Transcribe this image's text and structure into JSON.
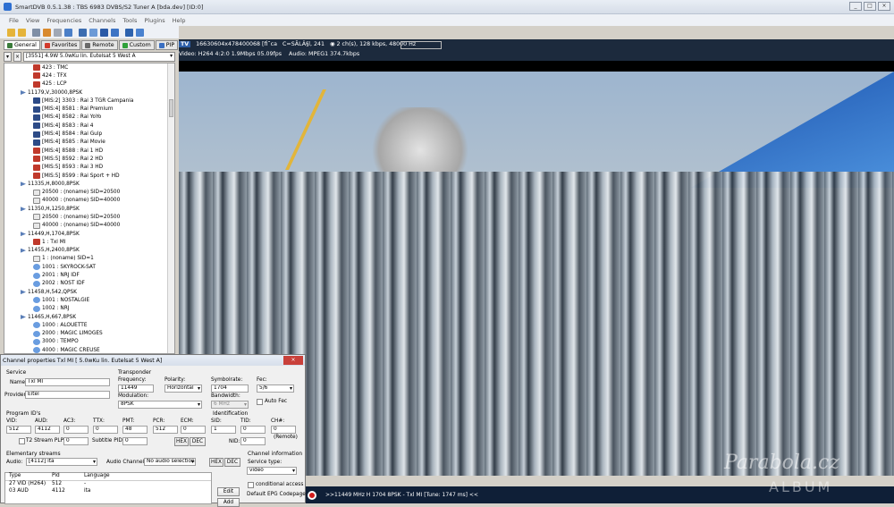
{
  "window": {
    "title": "SmartDVB 0.5.1.38 : TBS 6983 DVBS/S2 Tuner A [bda.dev] [ID:0]",
    "controls": [
      "_",
      "□",
      "×"
    ]
  },
  "menu": [
    "File",
    "View",
    "Frequencies",
    "Channels",
    "Tools",
    "Plugins",
    "Help"
  ],
  "tabs": [
    "General",
    "Favorites",
    "Remote",
    "Custom",
    "PIP"
  ],
  "satellite_selector": {
    "btn1": "▾",
    "btn2": "×",
    "value": "[3551] 4.9W 5.0wKu lin. Eutelsat 5 West A"
  },
  "tree": [
    {
      "t": "ch",
      "icon": "hd",
      "label": "423 : TMC"
    },
    {
      "t": "ch",
      "icon": "hd",
      "label": "424 : TFX"
    },
    {
      "t": "ch",
      "icon": "hd",
      "label": "425 : LCP"
    },
    {
      "t": "tp",
      "label": "11179,V,30000,8PSK"
    },
    {
      "t": "ch",
      "icon": "tv",
      "label": "[MIS:2] 3303 : Rai 3 TGR Campania"
    },
    {
      "t": "ch",
      "icon": "tv",
      "label": "[MIS:4] 8581 : Rai Premium"
    },
    {
      "t": "ch",
      "icon": "tv",
      "label": "[MIS:4] 8582 : Rai YoYo"
    },
    {
      "t": "ch",
      "icon": "tv",
      "label": "[MIS:4] 8583 : Rai 4"
    },
    {
      "t": "ch",
      "icon": "tv",
      "label": "[MIS:4] 8584 : Rai Gulp"
    },
    {
      "t": "ch",
      "icon": "tv",
      "label": "[MIS:4] 8585 : Rai Movie"
    },
    {
      "t": "ch",
      "icon": "hd",
      "label": "[MIS:4] 8588 : Rai 1 HD"
    },
    {
      "t": "ch",
      "icon": "hd",
      "label": "[MIS:5] 8592 : Rai 2 HD"
    },
    {
      "t": "ch",
      "icon": "hd",
      "label": "[MIS:5] 8593 : Rai 3 HD"
    },
    {
      "t": "ch",
      "icon": "hd",
      "label": "[MIS:5] 8599 : Rai Sport + HD"
    },
    {
      "t": "tp",
      "label": "11335,H,8000,8PSK"
    },
    {
      "t": "ch",
      "icon": "doc",
      "label": "20500 : (noname) SID=20500"
    },
    {
      "t": "ch",
      "icon": "doc",
      "label": "40000 : (noname) SID=40000"
    },
    {
      "t": "tp",
      "label": "11350,H,1250,8PSK"
    },
    {
      "t": "ch",
      "icon": "doc",
      "label": "20500 : (noname) SID=20500"
    },
    {
      "t": "ch",
      "icon": "doc",
      "label": "40000 : (noname) SID=40000"
    },
    {
      "t": "tp",
      "label": "11449,H,1704,8PSK"
    },
    {
      "t": "ch",
      "icon": "hd",
      "label": "1 : Txl MI"
    },
    {
      "t": "tp",
      "label": "11455,H,2400,8PSK"
    },
    {
      "t": "ch",
      "icon": "doc",
      "label": "1 : (noname) SID=1"
    },
    {
      "t": "ch",
      "icon": "radio",
      "label": "1001 : SKYROCK-SAT"
    },
    {
      "t": "ch",
      "icon": "radio",
      "label": "2001 : NRJ IDF"
    },
    {
      "t": "ch",
      "icon": "radio",
      "label": "2002 : NOST IDF"
    },
    {
      "t": "tp",
      "label": "11458,H,542,QPSK"
    },
    {
      "t": "ch",
      "icon": "radio",
      "label": "1001 : NOSTALGIE"
    },
    {
      "t": "ch",
      "icon": "radio",
      "label": "1002 : NRJ"
    },
    {
      "t": "tp",
      "label": "11465,H,667,8PSK"
    },
    {
      "t": "ch",
      "icon": "radio",
      "label": "1000 : ALOUETTE"
    },
    {
      "t": "ch",
      "icon": "radio",
      "label": "2000 : MAGIC LIMOGES"
    },
    {
      "t": "ch",
      "icon": "radio",
      "label": "3000 : TEMPO"
    },
    {
      "t": "ch",
      "icon": "radio",
      "label": "4000 : MAGIC CREUSE"
    }
  ],
  "infobar": {
    "badge": "TV",
    "line1": "16630604x478400068 [fÌ˜ca",
    "line1b": "C=SÃLÂ§l, 241",
    "audio_info": "2 ch(s), 128 kbps, 48000 Hz",
    "line2a": "Video: H264  4:2:0  1.9Mbps  05.09fps",
    "line2b": "Audio: MPEG1  374.7kbps"
  },
  "status": {
    "text": ">>11449 MHz H 1704 8PSK - Txl MI [Tune: 1747 ms] <<"
  },
  "watermark": {
    "main": "Parabola.cz",
    "sub": "ALBUM"
  },
  "dialog": {
    "title": "Channel properties Txl MI [ 5.0wKu lin. Eutelsat 5 West A]",
    "close": "×",
    "service_group": "Service",
    "name_label": "Name:",
    "name_value": "Txl MI",
    "provider_label": "Provider:",
    "provider_value": "Eitel",
    "transponder_group": "Transponder",
    "freq_label": "Frequency:",
    "freq_value": "11449",
    "pol_label": "Polarity:",
    "pol_value": "Horizontal",
    "sym_label": "Symbolrate:",
    "sym_value": "1704",
    "fec_label": "Fec:",
    "fec_value": "5/6",
    "mod_label": "Modulation:",
    "mod_value": "8PSK",
    "bw_label": "Bandwidth:",
    "bw_value": "6 MHz",
    "autofec_label": "Auto Fec",
    "pids_group": "Program ID's",
    "vid_label": "VID:",
    "vid_value": "512",
    "aud_label": "AUD:",
    "aud_value": "4112",
    "ac3_label": "AC3:",
    "ac3_value": "0",
    "ttx_label": "TTX:",
    "ttx_value": "0",
    "pmt_label": "PMT:",
    "pmt_value": "48",
    "pcr_label": "PCR:",
    "pcr_value": "512",
    "ecm_label": "ECM:",
    "ecm_value": "0",
    "ident_group": "Identification",
    "sid_label": "SID:",
    "sid_value": "1",
    "tid_label": "TID:",
    "tid_value": "0",
    "chnum_label": "CH#:",
    "chnum_value": "0",
    "remote_label": "(Remote)",
    "nid_label": "NID:",
    "nid_value": "0",
    "t2_label": "T2 Stream PLP",
    "t2_value": "0",
    "subpid_label": "Subtitle PID:",
    "subpid_value": "0",
    "hex_label": "HEX",
    "dec_label": "DEC",
    "es_group": "Elementary streams",
    "audio_label": "Audio:",
    "audio_value": "[4112] ita",
    "audio_channel_label": "Audio Channel:",
    "audio_channel_value": "No audio selection",
    "chinfo_group": "Channel information",
    "svc_type_label": "Service type:",
    "svc_type_value": "video",
    "cond_label": "conditional access",
    "epg_label": "Default EPG Codepage:",
    "es_columns": [
      "Type",
      "Pid",
      "Language"
    ],
    "es_rows": [
      [
        "27 VID (H264)",
        "512",
        "-"
      ],
      [
        "03 AUD",
        "4112",
        "ita"
      ]
    ],
    "edit_label": "Edit",
    "add_label": "Add"
  }
}
